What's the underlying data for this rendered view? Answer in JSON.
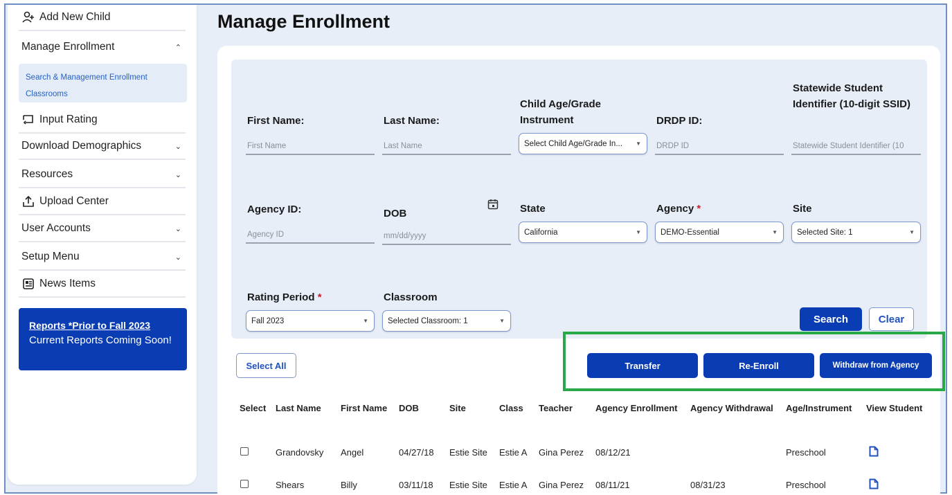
{
  "sidebar": {
    "add_child": "Add New Child",
    "manage_enrollment": "Manage Enrollment",
    "sub_items": [
      "Search & Management Enrollment",
      "Classrooms"
    ],
    "input_rating": "Input Rating",
    "download_demographics": "Download Demographics",
    "resources": "Resources",
    "upload_center": "Upload Center",
    "user_accounts": "User Accounts",
    "setup_menu": "Setup Menu",
    "news_items": "News Items",
    "reports_link": "Reports *Prior to Fall 2023",
    "reports_note": "Current Reports Coming Soon!"
  },
  "page": {
    "title": "Manage Enrollment"
  },
  "filters": {
    "first_name": {
      "label": "First Name:",
      "placeholder": "First Name"
    },
    "last_name": {
      "label": "Last Name:",
      "placeholder": "Last Name"
    },
    "child_age": {
      "label": "Child Age/Grade Instrument",
      "value": "Select Child Age/Grade In..."
    },
    "drdp_id": {
      "label": "DRDP ID:",
      "placeholder": "DRDP ID"
    },
    "ssid": {
      "label": "Statewide Student Identifier (10-digit SSID)",
      "placeholder": "Statewide Student Identifier (10"
    },
    "agency_id": {
      "label": "Agency ID:",
      "placeholder": "Agency ID"
    },
    "dob": {
      "label": "DOB",
      "placeholder": "mm/dd/yyyy"
    },
    "state": {
      "label": "State",
      "value": "California"
    },
    "agency": {
      "label": "Agency",
      "value": "DEMO-Essential"
    },
    "site": {
      "label": "Site",
      "value": "Selected Site: 1"
    },
    "rating_period": {
      "label": "Rating Period",
      "value": "Fall 2023"
    },
    "classroom": {
      "label": "Classroom",
      "value": "Selected Classroom: 1"
    },
    "required_mark": "*"
  },
  "actions": {
    "search": "Search",
    "clear": "Clear",
    "select_all": "Select All",
    "transfer": "Transfer",
    "re_enroll": "Re-Enroll",
    "withdraw": "Withdraw from Agency"
  },
  "table": {
    "headers": [
      "Select",
      "Last Name",
      "First Name",
      "DOB",
      "Site",
      "Class",
      "Teacher",
      "Agency Enrollment",
      "Agency Withdrawal",
      "Age/Instrument",
      "View Student"
    ],
    "rows": [
      {
        "last": "Grandovsky",
        "first": "Angel",
        "dob": "04/27/18",
        "site": "Estie Site",
        "class": "Estie A",
        "teacher": "Gina Perez",
        "enroll": "08/12/21",
        "withdraw": "",
        "age": "Preschool"
      },
      {
        "last": "Shears",
        "first": "Billy",
        "dob": "03/11/18",
        "site": "Estie Site",
        "class": "Estie A",
        "teacher": "Gina Perez",
        "enroll": "08/11/21",
        "withdraw": "08/31/23",
        "age": "Preschool"
      }
    ]
  },
  "colors": {
    "primary": "#0a3db3",
    "highlight": "#29a847",
    "required": "#d21f2b"
  }
}
